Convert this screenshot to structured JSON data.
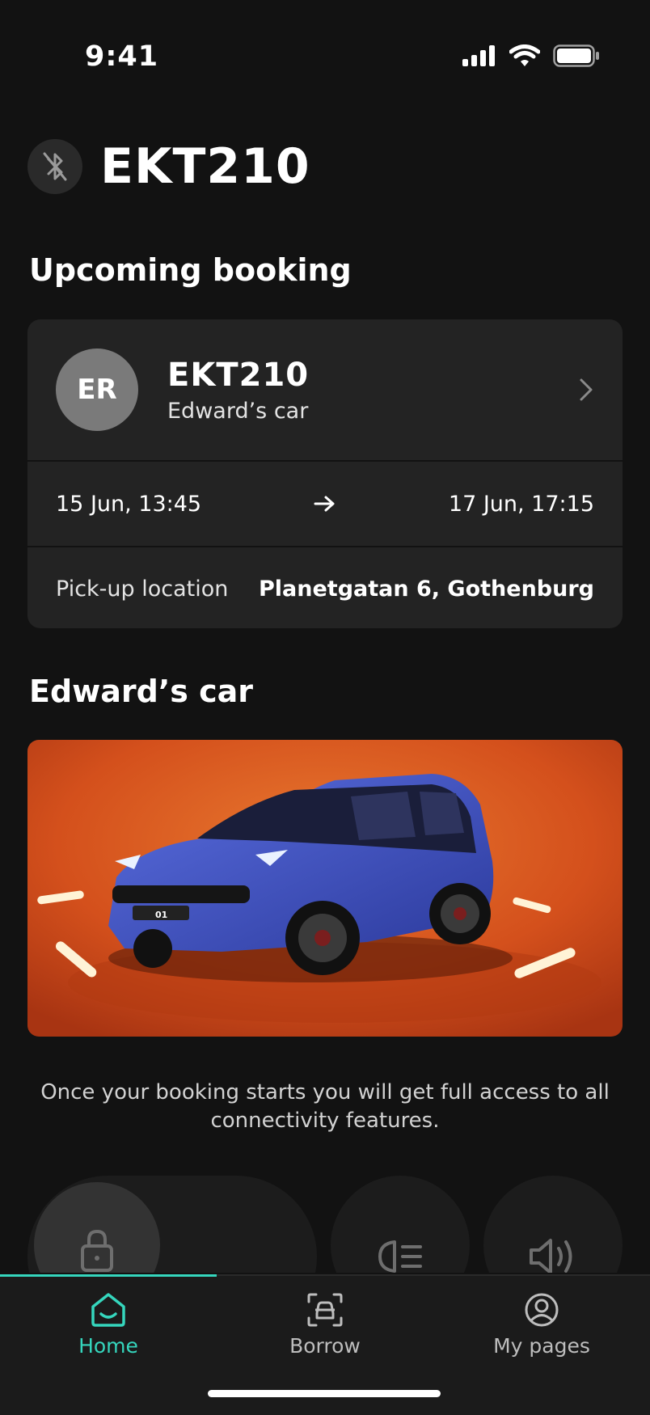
{
  "status_bar": {
    "time": "9:41"
  },
  "header": {
    "title": "EKT210",
    "bluetooth_icon": "bluetooth-off-icon"
  },
  "upcoming": {
    "section_title": "Upcoming booking",
    "avatar_initials": "ER",
    "plate": "EKT210",
    "car_name": "Edward’s car",
    "start": "15 Jun, 13:45",
    "end": "17 Jun, 17:15",
    "pickup_label": "Pick-up location",
    "pickup_value": "Planetgatan 6, Gothenburg"
  },
  "car_section": {
    "title": "Edward’s car",
    "plate_badge": "01",
    "info": "Once your booking starts you will get full access to all connectivity features."
  },
  "controls": {
    "icons": [
      "lock-icon",
      "headlight-icon",
      "horn-icon"
    ]
  },
  "nav": {
    "items": [
      {
        "label": "Home",
        "icon": "home-icon",
        "active": true
      },
      {
        "label": "Borrow",
        "icon": "car-icon",
        "active": false
      },
      {
        "label": "My pages",
        "icon": "profile-icon",
        "active": false
      }
    ]
  },
  "colors": {
    "accent": "#35d6bd",
    "background": "#121212",
    "card": "#232323",
    "car_body": "#3f54c6",
    "scene": "#d9531c"
  }
}
